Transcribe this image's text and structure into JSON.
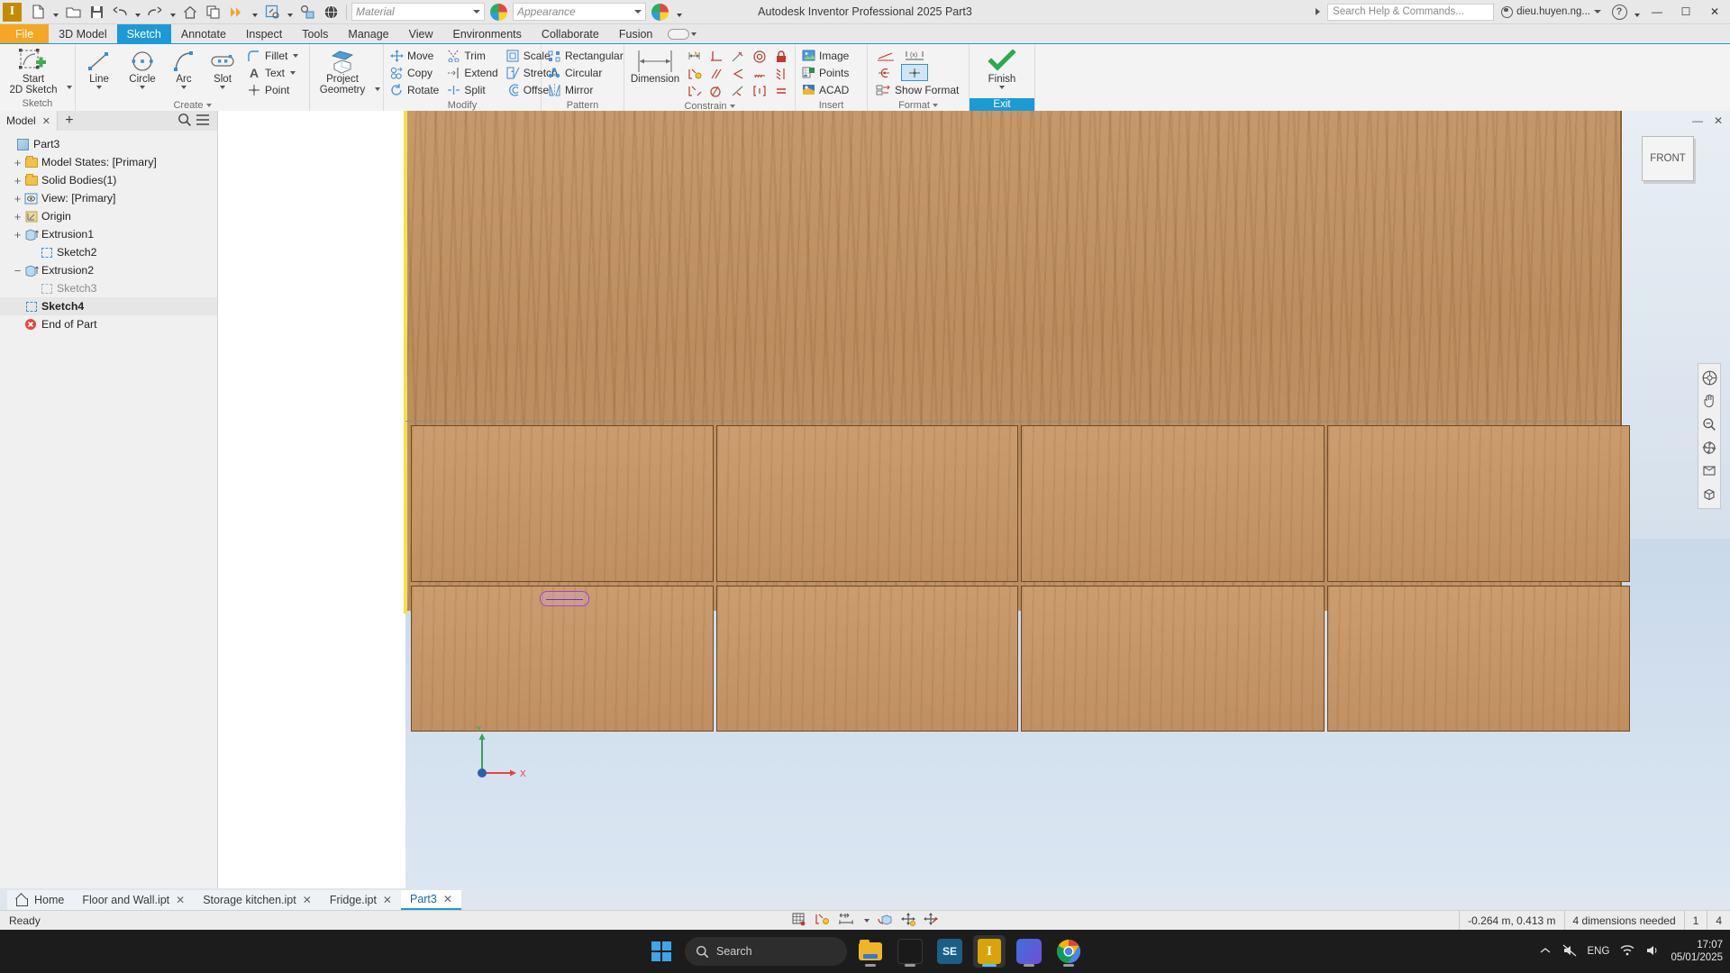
{
  "titlebar": {
    "app_title": "Autodesk Inventor Professional 2025   Part3",
    "logo_text": "I",
    "material_placeholder": "Material",
    "appearance_placeholder": "Appearance",
    "search_placeholder": "Search Help & Commands...",
    "user_name": "dieu.huyen.ng...",
    "help_icon": "?",
    "minimize": "—",
    "maximize": "☐",
    "close": "✕",
    "qat_icons": [
      "new-icon",
      "open-icon",
      "save-icon",
      "undo-icon",
      "redo-icon",
      "home-icon",
      "copy-icon",
      "update-icon",
      "select-icon",
      "appearance-override-icon",
      "material-sphere-icon"
    ]
  },
  "ribbon_tabs": [
    {
      "label": "File",
      "style": "file"
    },
    {
      "label": "3D Model",
      "style": "normal"
    },
    {
      "label": "Sketch",
      "style": "active"
    },
    {
      "label": "Annotate",
      "style": "normal"
    },
    {
      "label": "Inspect",
      "style": "normal"
    },
    {
      "label": "Tools",
      "style": "normal"
    },
    {
      "label": "Manage",
      "style": "normal"
    },
    {
      "label": "View",
      "style": "normal"
    },
    {
      "label": "Environments",
      "style": "normal"
    },
    {
      "label": "Collaborate",
      "style": "normal"
    },
    {
      "label": "Fusion",
      "style": "normal"
    }
  ],
  "ribbon": {
    "groups": {
      "sketch": {
        "title": "Sketch",
        "start_2d_sketch": "Start\n2D Sketch"
      },
      "create": {
        "title": "Create",
        "line": "Line",
        "circle": "Circle",
        "arc": "Arc",
        "slot": "Slot",
        "fillet": "Fillet",
        "text": "Text",
        "point": "Point",
        "project_geometry": "Project\nGeometry"
      },
      "modify": {
        "title": "Modify",
        "move": "Move",
        "copy": "Copy",
        "rotate": "Rotate",
        "trim": "Trim",
        "extend": "Extend",
        "split": "Split",
        "scale": "Scale",
        "stretch": "Stretch",
        "offset": "Offset"
      },
      "pattern": {
        "title": "Pattern",
        "rectangular": "Rectangular",
        "circular": "Circular",
        "mirror": "Mirror"
      },
      "constrain": {
        "title": "Constrain",
        "dimension": "Dimension",
        "icons": [
          "auto-dimension-icon",
          "perpendicular-icon",
          "tangent-icon",
          "concentric-icon",
          "lock-icon",
          "show-constraints-icon",
          "parallel-icon",
          "coincident-icon",
          "collinear-icon",
          "symmetric-icon",
          "relax-mode-icon",
          "equal-radius-icon",
          "smooth-icon",
          "horizontal-icon",
          "equal-icon"
        ]
      },
      "insert": {
        "title": "Insert",
        "image": "Image",
        "points": "Points",
        "acad": "ACAD"
      },
      "format": {
        "title": "Format",
        "show_format": "Show Format",
        "icons": [
          "construction-line-icon",
          "driven-dimension-icon",
          "centerline-icon",
          "center-point-icon"
        ]
      },
      "exit": {
        "finish": "Finish",
        "exit": "Exit"
      }
    }
  },
  "browser": {
    "tab_label": "Model",
    "tab_close": "✕",
    "add_tab": "+",
    "search_icon": "search-icon",
    "menu_icon": "hamburger-icon",
    "tree": [
      {
        "label": "Part3",
        "indent": 0,
        "expander": "",
        "icon": "part-cube-icon",
        "selected": false
      },
      {
        "label": "Model States: [Primary]",
        "indent": 1,
        "expander": "+",
        "icon": "folder-icon",
        "selected": false
      },
      {
        "label": "Solid Bodies(1)",
        "indent": 1,
        "expander": "+",
        "icon": "folder-icon",
        "selected": false
      },
      {
        "label": "View: [Primary]",
        "indent": 1,
        "expander": "+",
        "icon": "view-eye-icon",
        "selected": false
      },
      {
        "label": "Origin",
        "indent": 1,
        "expander": "+",
        "icon": "origin-icon",
        "selected": false
      },
      {
        "label": "Extrusion1",
        "indent": 1,
        "expander": "+",
        "icon": "extrusion-icon",
        "selected": false
      },
      {
        "label": "Sketch2",
        "indent": 2,
        "expander": "",
        "icon": "sketch-icon",
        "selected": false
      },
      {
        "label": "Extrusion2",
        "indent": 1,
        "expander": "−",
        "icon": "extrusion-icon",
        "selected": false
      },
      {
        "label": "Sketch3",
        "indent": 2,
        "expander": "",
        "icon": "sketch-dim-icon",
        "selected": false
      },
      {
        "label": "Sketch4",
        "indent": 1,
        "expander": "",
        "icon": "sketch-icon",
        "selected": true
      },
      {
        "label": "End of Part",
        "indent": 1,
        "expander": "",
        "icon": "end-of-part-icon",
        "selected": false
      }
    ]
  },
  "viewport": {
    "viewcube_face": "FRONT",
    "axis_x": "X",
    "axis_y": "Y",
    "minimize": "—",
    "close": "✕",
    "nav_icons": [
      "full-navigation-wheel-icon",
      "pan-icon",
      "zoom-icon",
      "orbit-icon",
      "look-at-icon",
      "view-face-icon"
    ]
  },
  "doc_tabs": [
    {
      "label": "Home",
      "closable": false,
      "active": false,
      "icon": "home-icon"
    },
    {
      "label": "Floor and Wall.ipt",
      "closable": true,
      "active": false
    },
    {
      "label": "Storage kitchen.ipt",
      "closable": true,
      "active": false
    },
    {
      "label": "Fridge.ipt",
      "closable": true,
      "active": false
    },
    {
      "label": "Part3",
      "closable": true,
      "active": true
    }
  ],
  "status": {
    "ready": "Ready",
    "coordinates": "-0.264 m, 0.413 m",
    "dimensions_needed": "4 dimensions needed",
    "count_1": "1",
    "count_2": "4",
    "center_icons": [
      "grid-snap-icon",
      "constraint-display-icon",
      "dimension-display-icon",
      "slice-graphics-icon",
      "dof-icon",
      "drag-icon"
    ]
  },
  "taskbar": {
    "search_placeholder": "Search",
    "language": "ENG",
    "time": "17:07",
    "date": "05/01/2025",
    "apps": [
      "file-explorer-icon",
      "game-icon",
      "sublime-editor-icon",
      "inventor-icon",
      "photos-icon",
      "chrome-icon"
    ],
    "tray_icons": [
      "show-hidden-icon",
      "mute-icon",
      "wifi-icon",
      "volume-icon"
    ]
  },
  "colors": {
    "accent": "#1b9ad6",
    "file_tab": "#f5a623",
    "wood": "#c79a6d",
    "sketch_purple": "#a63fd9"
  }
}
